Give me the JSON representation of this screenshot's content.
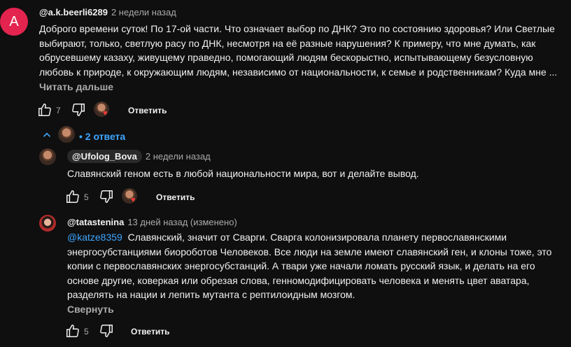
{
  "comment": {
    "avatar_letter": "A",
    "author": "@a.k.beerli6289",
    "time": "2 недели назад",
    "lines": [
      "Доброго времени суток! По 17-ой части. Что означает выбор по ДНК? Это по состоянию здоровья? Или Светлые",
      "выбирают, только, светлую расу по ДНК, несмотря на её разные нарушения? К примеру, что мне думать, как",
      "обрусевшему казаху, живущему праведно, помогающий людям бескорыстно, испытывающему безусловную",
      "любовь к природе, к окружающим людям, независимо от национальности, к семье и родственникам? Куда мне ..."
    ],
    "read_more": "Читать дальше",
    "likes": "7",
    "reply": "Ответить"
  },
  "replies_toggle": {
    "label": "• 2 ответа"
  },
  "replies": [
    {
      "author": "@Ufolog_Bova",
      "time": "2 недели назад",
      "text": "Славянский геном есть в любой национальности мира, вот и делайте вывод.",
      "likes": "5",
      "reply": "Ответить"
    },
    {
      "author": "@tatastenina",
      "time": "13 дней назад (изменено)",
      "mention": "@katze8359",
      "lines": [
        "Славянский, значит от Сварги. Сварга колонизировала планету первославянскими",
        "энергосубстанциями биороботов Человеков. Все люди на земле имеют славянский ген, и клоны тоже,  это",
        "копии с первославянских энергосубстанций. А твари уже начали ломать русский язык, и делать на его",
        "основе другие, коверкая или обрезая слова, генномодифицировать человека и менять цвет аватара,",
        "разделять на нации и лепить мутанта с рептилоидным мозгом."
      ],
      "collapse": "Свернуть",
      "likes": "5",
      "reply": "Ответить"
    }
  ],
  "icons": {
    "like": "thumb-up-icon",
    "dislike": "thumb-down-icon",
    "heart": "heart-icon",
    "toggle": "chevron-up-icon"
  }
}
